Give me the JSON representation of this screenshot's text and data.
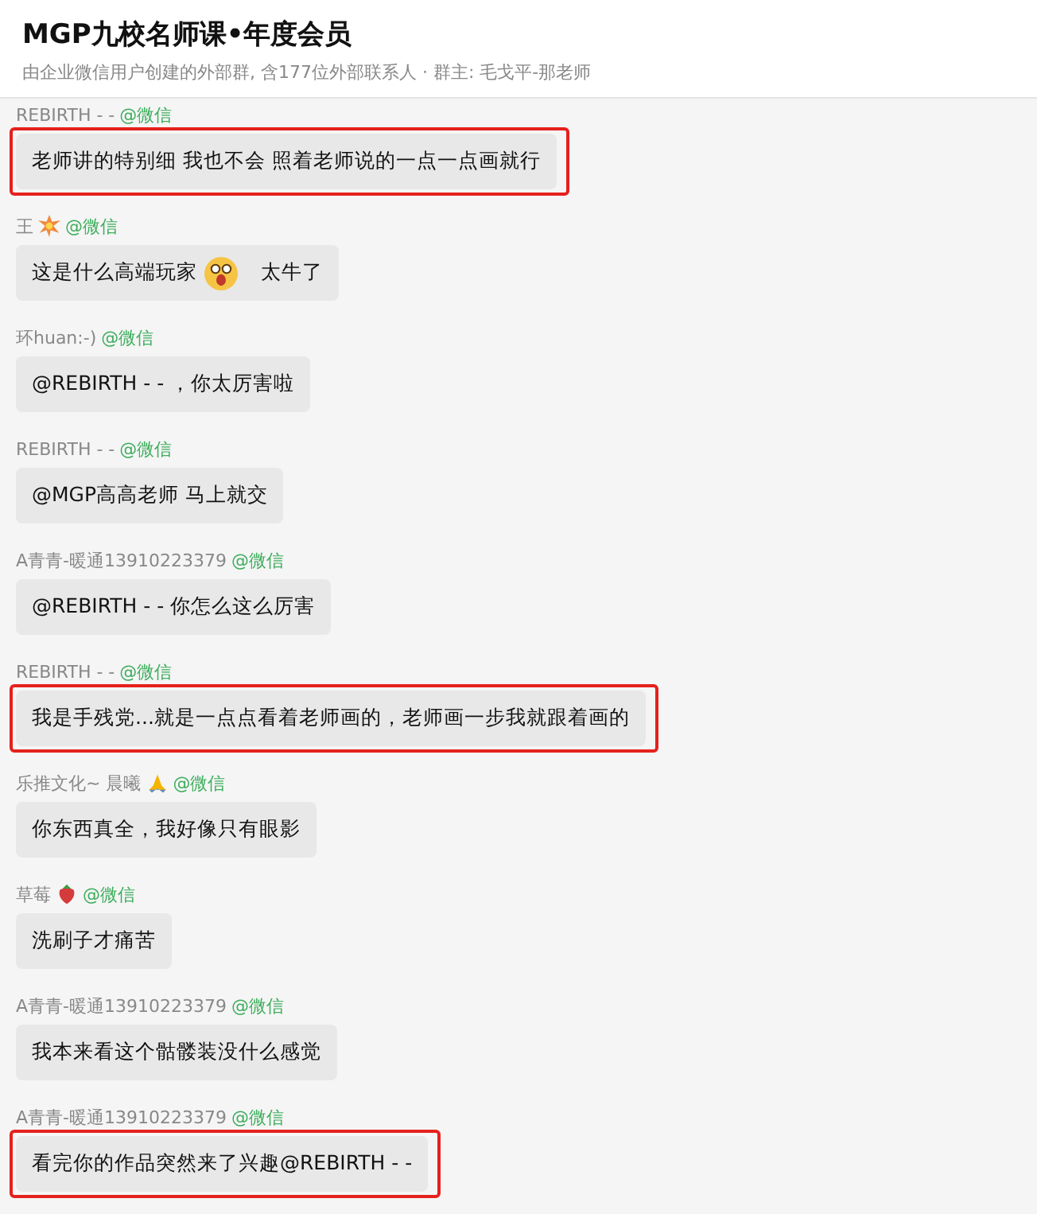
{
  "header": {
    "title": "MGP九校名师课•年度会员",
    "subtitle": "由企业微信用户创建的外部群, 含177位外部联系人 · 群主: 毛戈平-那老师"
  },
  "messages": [
    {
      "sender": "REBIRTH - -",
      "source": "@微信",
      "highlighted": true,
      "segments": [
        {
          "kind": "text",
          "text": "老师讲的特别细  我也不会  照着老师说的一点一点画就行"
        }
      ]
    },
    {
      "sender": "王",
      "sender_icon": {
        "kind": "burst"
      },
      "source": "@微信",
      "highlighted": false,
      "segments": [
        {
          "kind": "text",
          "text": "这是什么高端玩家"
        },
        {
          "kind": "emoji"
        },
        {
          "kind": "text",
          "text": "太牛了"
        }
      ]
    },
    {
      "sender": "环huan:-)",
      "source": "@微信",
      "highlighted": false,
      "segments": [
        {
          "kind": "text",
          "text": "@REBIRTH - - ，你太厉害啦"
        }
      ]
    },
    {
      "sender": "REBIRTH - -",
      "source": "@微信",
      "highlighted": false,
      "segments": [
        {
          "kind": "text",
          "text": "@MGP高高老师  马上就交"
        }
      ]
    },
    {
      "sender": "A青青-暖通13910223379",
      "source": "@微信",
      "highlighted": false,
      "segments": [
        {
          "kind": "text",
          "text": "@REBIRTH - -  你怎么这么厉害"
        }
      ]
    },
    {
      "sender": "REBIRTH - -",
      "source": "@微信",
      "highlighted": true,
      "segments": [
        {
          "kind": "text",
          "text": "我是手残党...就是一点点看着老师画的，老师画一步我就跟着画的"
        }
      ]
    },
    {
      "sender": "乐推文化~  晨曦",
      "sender_icon": {
        "kind": "hands"
      },
      "source": "@微信",
      "highlighted": false,
      "segments": [
        {
          "kind": "text",
          "text": "你东西真全，我好像只有眼影"
        }
      ]
    },
    {
      "sender": "草莓",
      "sender_icon": {
        "kind": "berry"
      },
      "source": "@微信",
      "highlighted": false,
      "segments": [
        {
          "kind": "text",
          "text": "洗刷子才痛苦"
        }
      ]
    },
    {
      "sender": "A青青-暖通13910223379",
      "source": "@微信",
      "highlighted": false,
      "segments": [
        {
          "kind": "text",
          "text": "我本来看这个骷髅装没什么感觉"
        }
      ]
    },
    {
      "sender": "A青青-暖通13910223379",
      "source": "@微信",
      "highlighted": true,
      "segments": [
        {
          "kind": "text",
          "text": "看完你的作品突然来了兴趣@REBIRTH - -"
        }
      ]
    }
  ]
}
